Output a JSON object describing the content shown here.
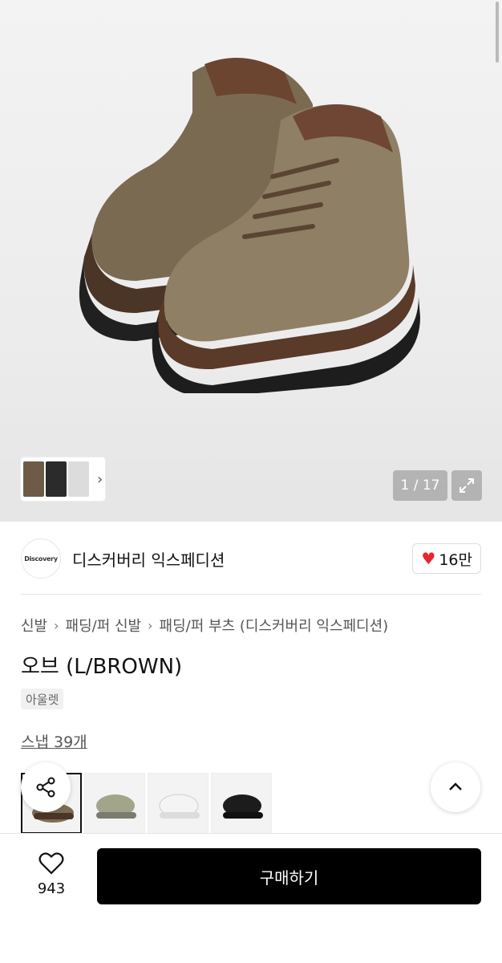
{
  "gallery": {
    "counter": "1 / 17",
    "thumb_strip_icon": "chevron-right-icon",
    "expand_icon": "expand-icon"
  },
  "brand": {
    "logo_text": "Discovery",
    "name": "디스커버리 익스페디션",
    "likes": "16만",
    "like_icon": "heart-icon",
    "like_color": "#e8262d"
  },
  "breadcrumb": {
    "items": [
      "신발",
      "패딩/퍼 신발",
      "패딩/퍼 부츠 (디스커버리 익스페디션)"
    ]
  },
  "product": {
    "title": "오브 (L/BROWN)",
    "tag": "아울렛",
    "snap_link": "스냅 39개"
  },
  "variants": [
    {
      "color_name": "brown",
      "swatch": "#8a7a63"
    },
    {
      "color_name": "khaki",
      "swatch": "#a3a58a"
    },
    {
      "color_name": "white",
      "swatch": "#efefef"
    },
    {
      "color_name": "black",
      "swatch": "#1c1c1c"
    }
  ],
  "bottom_bar": {
    "wish_count": "943",
    "buy_label": "구매하기"
  }
}
